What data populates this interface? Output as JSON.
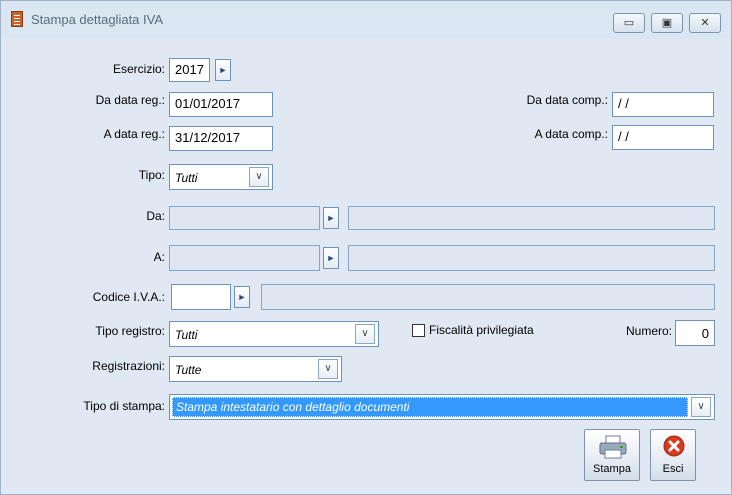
{
  "window": {
    "title": "Stampa dettagliata IVA",
    "minimize_glyph": "▭",
    "maximize_glyph": "▣",
    "close_glyph": "✕"
  },
  "form": {
    "esercizio": {
      "label": "Esercizio:",
      "value": "2017"
    },
    "da_data_reg": {
      "label": "Da data reg.:",
      "value": "01/01/2017"
    },
    "a_data_reg": {
      "label": "A data reg.:",
      "value": "31/12/2017"
    },
    "da_data_comp": {
      "label": "Da data comp.:",
      "value": " /  /"
    },
    "a_data_comp": {
      "label": "A data comp.:",
      "value": " /  /"
    },
    "tipo": {
      "label": "Tipo:",
      "value": "Tutti"
    },
    "da": {
      "label": "Da:",
      "value": "",
      "descr": ""
    },
    "a": {
      "label": "A:",
      "value": "",
      "descr": ""
    },
    "codice_iva": {
      "label": "Codice I.V.A.:",
      "value": "",
      "descr": ""
    },
    "tipo_registro": {
      "label": "Tipo registro:",
      "value": "Tutti"
    },
    "fiscalita": {
      "label": "Fiscalità privilegiata",
      "checked": false
    },
    "numero": {
      "label": "Numero:",
      "value": "0"
    },
    "registrazioni": {
      "label": "Registrazioni:",
      "value": "Tutte"
    },
    "tipo_stampa": {
      "label": "Tipo di stampa:",
      "value": "Stampa intestatario con dettaglio documenti"
    }
  },
  "buttons": {
    "stampa": "Stampa",
    "esci": "Esci"
  },
  "glyphs": {
    "zoom": "►",
    "dropdown": "∨"
  },
  "colors": {
    "selected_bg": "#3399ff",
    "esci_red": "#d83a20"
  }
}
